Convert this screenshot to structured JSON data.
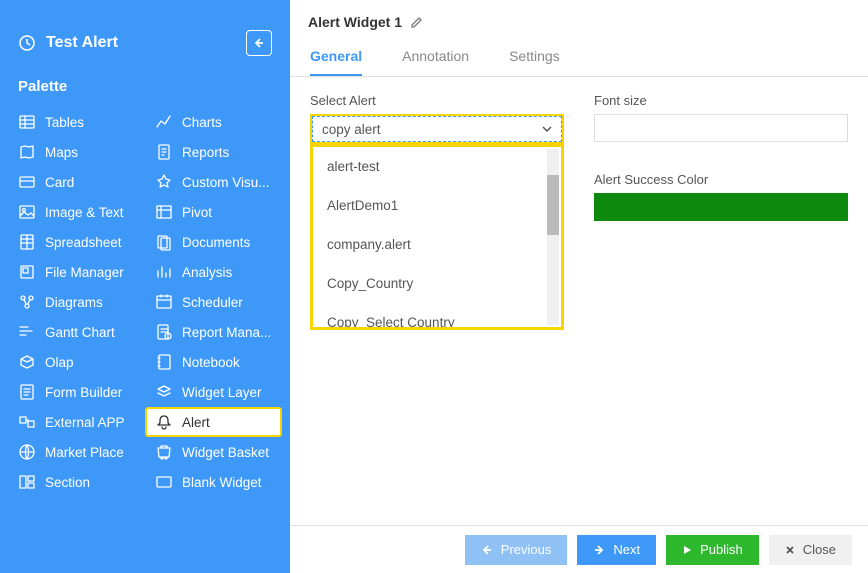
{
  "sidebar": {
    "title": "Test Alert",
    "palette_label": "Palette",
    "items_left": [
      {
        "label": "Tables",
        "icon": "tables"
      },
      {
        "label": "Maps",
        "icon": "maps"
      },
      {
        "label": "Card",
        "icon": "card"
      },
      {
        "label": "Image & Text",
        "icon": "image"
      },
      {
        "label": "Spreadsheet",
        "icon": "spreadsheet"
      },
      {
        "label": "File Manager",
        "icon": "file"
      },
      {
        "label": "Diagrams",
        "icon": "diagram"
      },
      {
        "label": "Gantt Chart",
        "icon": "gantt"
      },
      {
        "label": "Olap",
        "icon": "olap"
      },
      {
        "label": "Form Builder",
        "icon": "form"
      },
      {
        "label": "External APP",
        "icon": "external"
      },
      {
        "label": "Market Place",
        "icon": "market"
      },
      {
        "label": "Section",
        "icon": "section"
      }
    ],
    "items_right": [
      {
        "label": "Charts",
        "icon": "charts"
      },
      {
        "label": "Reports",
        "icon": "reports"
      },
      {
        "label": "Custom Visu...",
        "icon": "custom"
      },
      {
        "label": "Pivot",
        "icon": "pivot"
      },
      {
        "label": "Documents",
        "icon": "documents"
      },
      {
        "label": "Analysis",
        "icon": "analysis"
      },
      {
        "label": "Scheduler",
        "icon": "scheduler"
      },
      {
        "label": "Report Mana...",
        "icon": "reportm"
      },
      {
        "label": "Notebook",
        "icon": "notebook"
      },
      {
        "label": "Widget Layer",
        "icon": "layer"
      },
      {
        "label": "Alert",
        "icon": "alert",
        "highlighted": true
      },
      {
        "label": "Widget Basket",
        "icon": "basket"
      },
      {
        "label": "Blank Widget",
        "icon": "blank"
      }
    ]
  },
  "header": {
    "title": "Alert Widget 1"
  },
  "tabs": [
    {
      "label": "General",
      "active": true
    },
    {
      "label": "Annotation",
      "active": false
    },
    {
      "label": "Settings",
      "active": false
    }
  ],
  "form": {
    "select_alert_label": "Select Alert",
    "select_alert_value": "copy alert",
    "dropdown_options": [
      "alert-test",
      "AlertDemo1",
      "company.alert",
      "Copy_Country",
      "Copy_Select Country"
    ],
    "font_size_label": "Font size",
    "font_size_value": "",
    "alert_success_label": "Alert Success Color",
    "alert_success_color": "#0d8a0d"
  },
  "footer": {
    "previous": "Previous",
    "next": "Next",
    "publish": "Publish",
    "close": "Close"
  }
}
